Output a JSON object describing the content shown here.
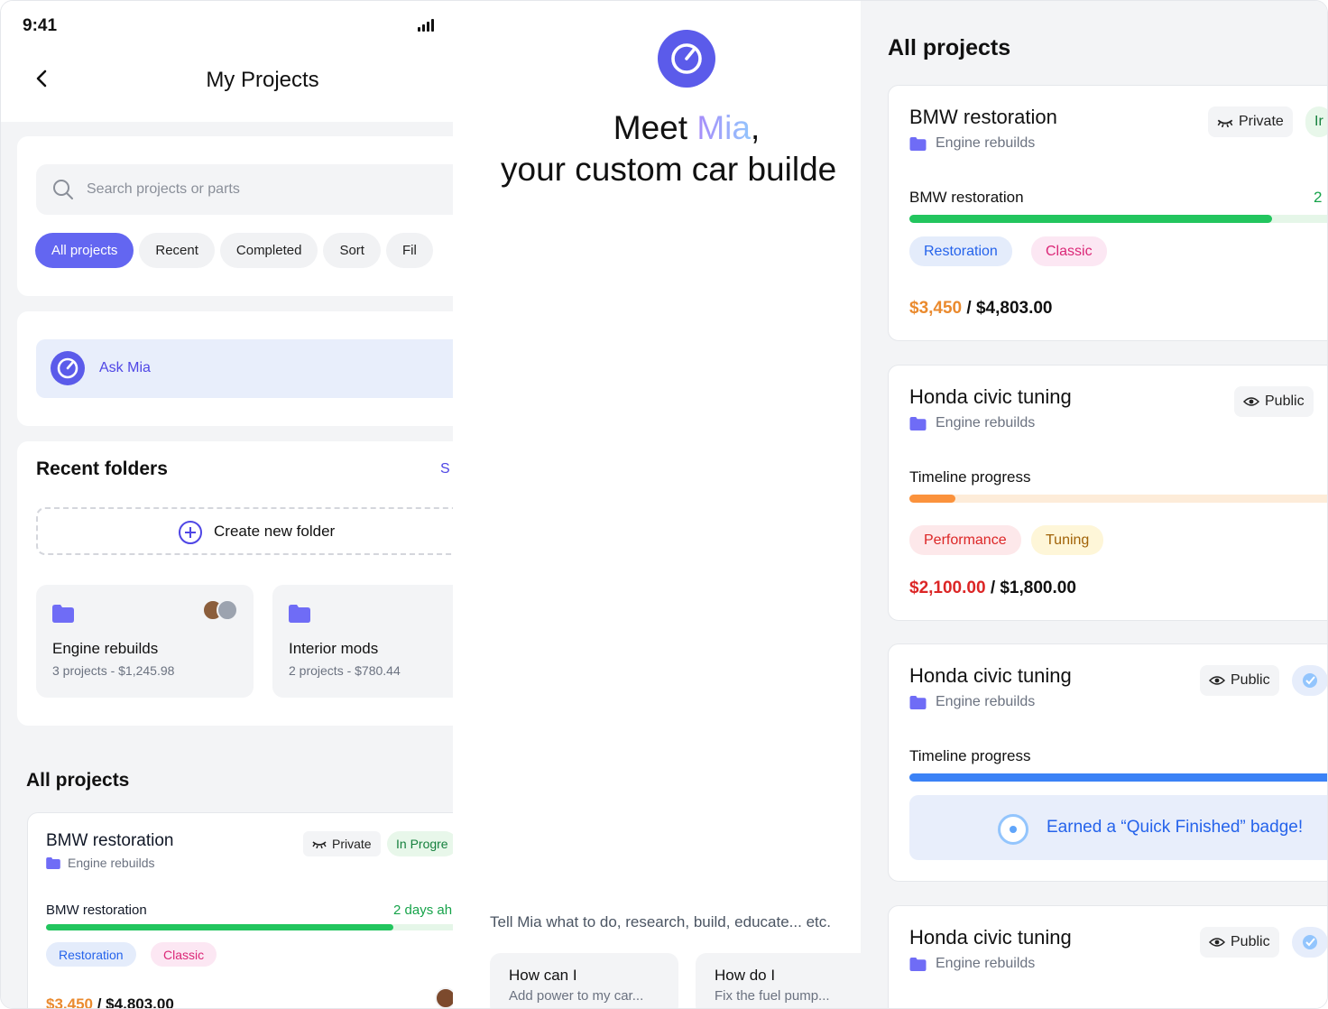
{
  "phone": {
    "status_time": "9:41",
    "header_title": "My Projects",
    "search_placeholder": "Search projects or parts",
    "filters": [
      "All projects",
      "Recent",
      "Completed",
      "Sort",
      "Fil"
    ],
    "ask_mia": "Ask Mia",
    "recent_folders_title": "Recent folders",
    "see_all": "S",
    "create_folder": "Create new folder",
    "folders": [
      {
        "name": "Engine rebuilds",
        "meta": "3 projects - $1,245.98"
      },
      {
        "name": "Interior mods",
        "meta": "2 projects - $780.44"
      }
    ],
    "all_projects_title": "All projects",
    "project": {
      "title": "BMW restoration",
      "folder": "Engine rebuilds",
      "visibility": "Private",
      "status": "In Progre",
      "progress_label": "BMW restoration",
      "progress_right": "2 days ah",
      "progress": 0.77,
      "tags": [
        "Restoration",
        "Classic"
      ],
      "spent": "$3,450",
      "budget": "/ $4,803.00"
    }
  },
  "mia": {
    "title_prefix": "Meet ",
    "title_name": "Mia",
    "title_suffix": ",",
    "subtitle": "your custom car builde",
    "hint": "Tell Mia what to do, research, build, educate... etc.",
    "suggestions": [
      {
        "title": "How can I",
        "sub": "Add power to my car..."
      },
      {
        "title": "How do I",
        "sub": "Fix the fuel pump..."
      }
    ]
  },
  "projects_panel": {
    "title": "All projects",
    "cards": [
      {
        "title": "BMW restoration",
        "folder": "Engine rebuilds",
        "visibility": "Private",
        "status": "Ir",
        "progress_label": "BMW restoration",
        "progress_right": "2",
        "progress": 0.86,
        "tags": [
          "Restoration",
          "Classic"
        ],
        "spent": "$3,450",
        "budget": "/ $4,803.00"
      },
      {
        "title": "Honda civic tuning",
        "folder": "Engine rebuilds",
        "visibility": "Public",
        "progress_label": "Timeline progress",
        "progress": 0.11,
        "tags": [
          "Performance",
          "Tuning"
        ],
        "spent": "$2,100.00",
        "budget": "/ $1,800.00"
      },
      {
        "title": "Honda civic tuning",
        "folder": "Engine rebuilds",
        "visibility": "Public",
        "progress_label": "Timeline progress",
        "progress": 1.0,
        "badge": "Earned a “Quick Finished” badge!"
      },
      {
        "title": "Honda civic tuning",
        "folder": "Engine rebuilds",
        "visibility": "Public"
      }
    ]
  },
  "colors": {
    "accent": "#6366f1",
    "green": "#22c55e",
    "orange": "#fb923c",
    "blue": "#3b82f6",
    "over_budget": "#dc2626",
    "spent": "#ea8a2e"
  }
}
